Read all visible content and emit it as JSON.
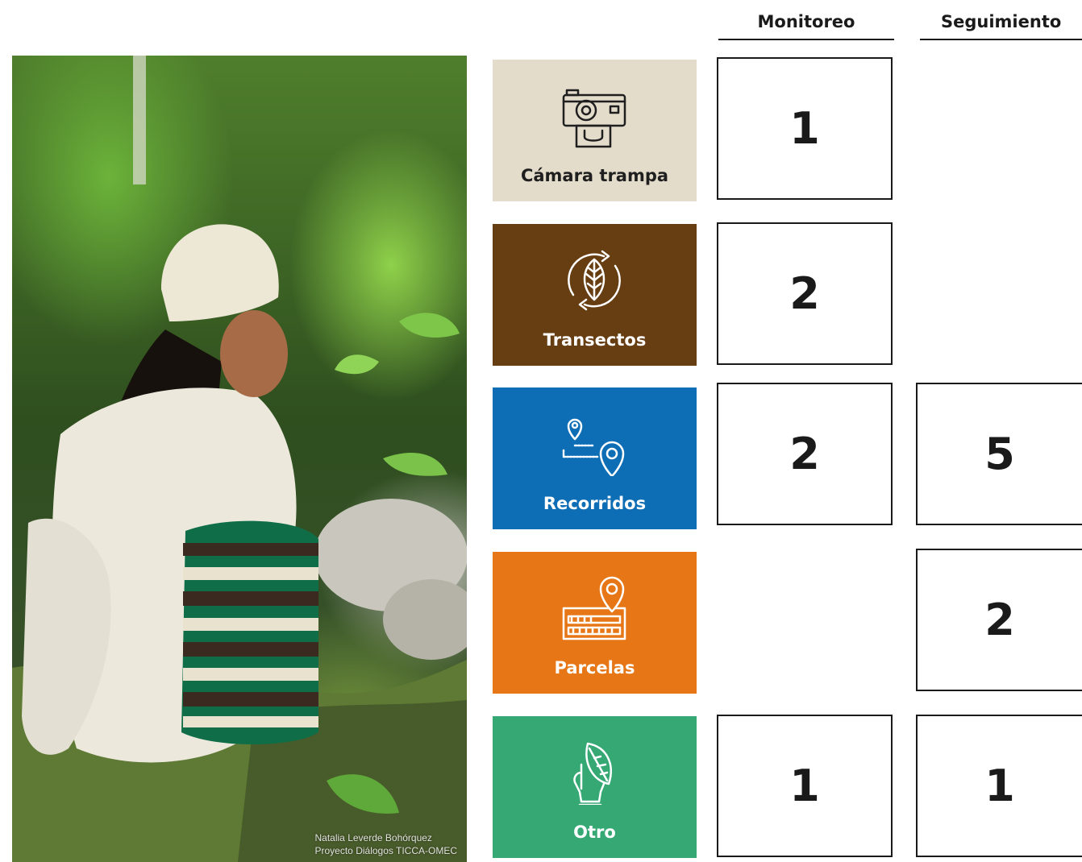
{
  "headers": {
    "monitoreo": "Monitoreo",
    "seguimiento": "Seguimiento"
  },
  "photo": {
    "credit_line1": "Natalia Leverde Bohórquez",
    "credit_line2": "Proyecto Diálogos TICCA-OMEC"
  },
  "categories": [
    {
      "label": "Cámara trampa",
      "icon": "trap-camera-icon",
      "color": "#e4dccb",
      "monitoreo": "1",
      "seguimiento": ""
    },
    {
      "label": "Transectos",
      "icon": "leaf-cycle-icon",
      "color": "#673d12",
      "monitoreo": "2",
      "seguimiento": ""
    },
    {
      "label": "Recorridos",
      "icon": "route-pins-icon",
      "color": "#0e6eb5",
      "monitoreo": "2",
      "seguimiento": "5"
    },
    {
      "label": "Parcelas",
      "icon": "plot-pin-icon",
      "color": "#e77716",
      "monitoreo": "",
      "seguimiento": "2"
    },
    {
      "label": "Otro",
      "icon": "hand-leaf-icon",
      "color": "#35a874",
      "monitoreo": "1",
      "seguimiento": "1"
    }
  ]
}
